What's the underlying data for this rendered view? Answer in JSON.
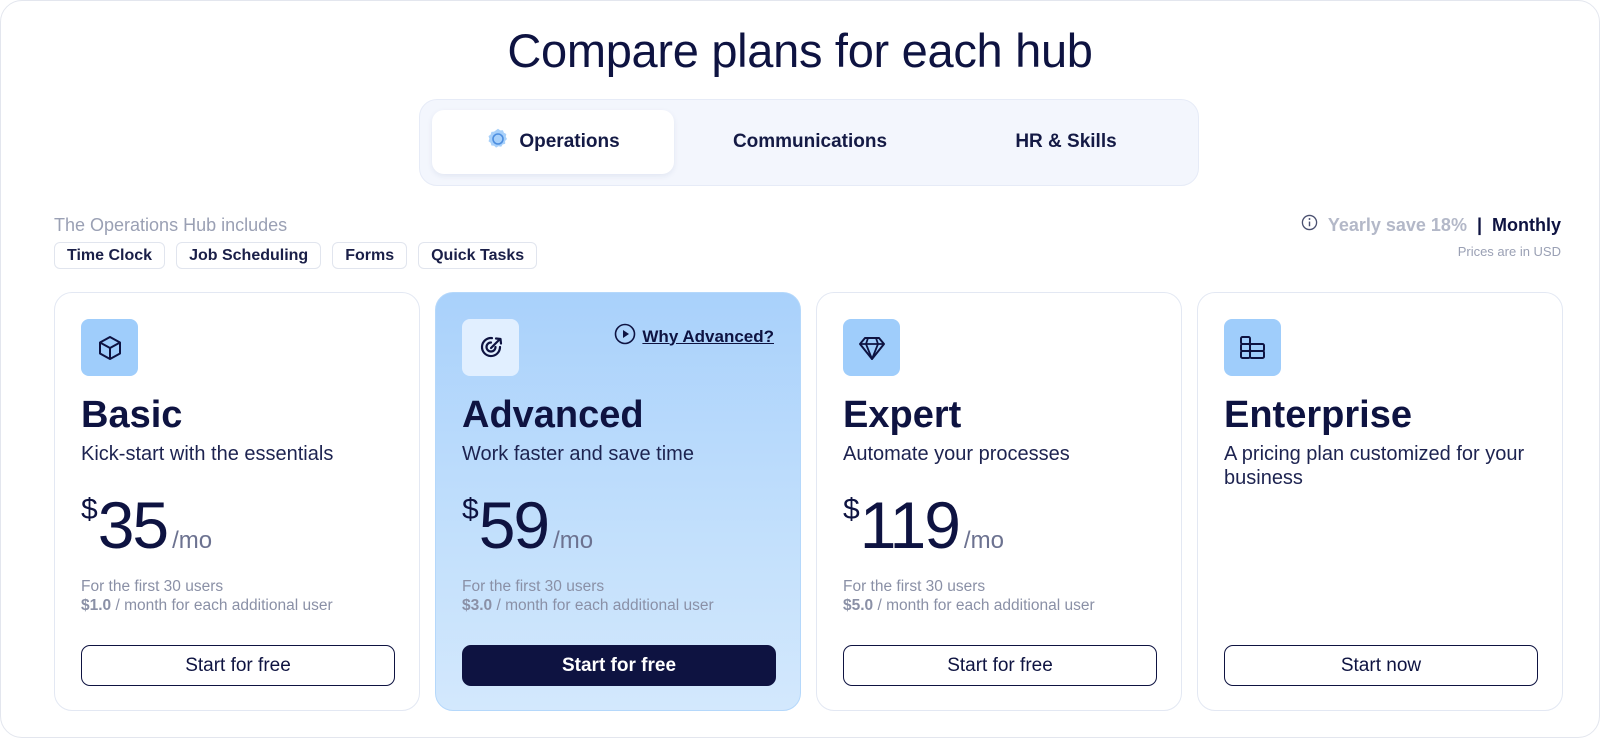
{
  "page": {
    "title": "Compare plans for each hub"
  },
  "tabs": [
    {
      "label": "Operations",
      "active": true,
      "icon": "gear-badge-icon"
    },
    {
      "label": "Communications",
      "active": false
    },
    {
      "label": "HR & Skills",
      "active": false
    }
  ],
  "hub": {
    "includes_label": "The Operations Hub includes",
    "chips": [
      "Time Clock",
      "Job Scheduling",
      "Forms",
      "Quick Tasks"
    ]
  },
  "billing": {
    "yearly_label": "Yearly save 18%",
    "separator": "|",
    "monthly_label": "Monthly",
    "selected": "Monthly",
    "currency_note": "Prices are in USD"
  },
  "plans": [
    {
      "name": "Basic",
      "icon": "cube-icon",
      "description": "Kick-start with the essentials",
      "currency": "$",
      "price": "35",
      "period": "/mo",
      "users_line": "For the first 30 users",
      "extra_price": "$1.0",
      "extra_text": " / month for each additional user",
      "cta": "Start for free"
    },
    {
      "name": "Advanced",
      "icon": "target-icon",
      "why_label": "Why Advanced?",
      "description": "Work faster and save time",
      "currency": "$",
      "price": "59",
      "period": "/mo",
      "users_line": "For the first 30 users",
      "extra_price": "$3.0",
      "extra_text": " / month for each additional user",
      "cta": "Start for free",
      "featured": true
    },
    {
      "name": "Expert",
      "icon": "diamond-icon",
      "description": "Automate your processes",
      "currency": "$",
      "price": "119",
      "period": "/mo",
      "users_line": "For the first 30 users",
      "extra_price": "$5.0",
      "extra_text": " / month for each additional user",
      "cta": "Start for free"
    },
    {
      "name": "Enterprise",
      "icon": "blocks-icon",
      "description": "A pricing plan customized for your business",
      "cta": "Start now"
    }
  ],
  "colors": {
    "navy": "#0e1341",
    "featured_bg": "#a9d1fb",
    "icon_bg": "#9fcdfb",
    "muted": "#9aa0b4"
  }
}
